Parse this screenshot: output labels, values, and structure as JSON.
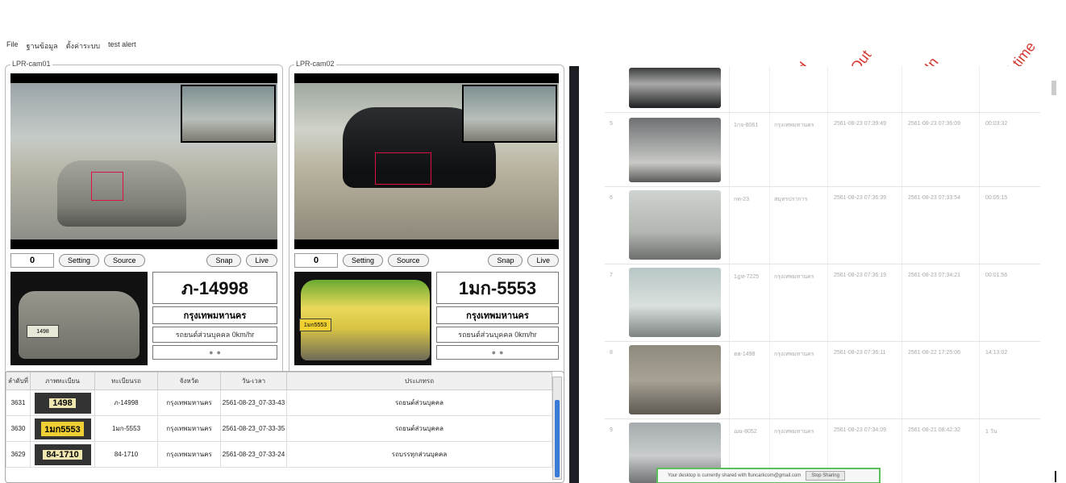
{
  "menu": [
    "File",
    "ฐานข้อมูล",
    "ตั้งค่าระบบ",
    "test alert"
  ],
  "cameras": [
    {
      "label": "LPR-cam01",
      "count": "0",
      "buttons": {
        "setting": "Setting",
        "source": "Source",
        "snap": "Snap",
        "live": "Live"
      },
      "plate": "ภ-14998",
      "province": "กรุงเทพมหานคร",
      "vehicle_type": "รถยนต์ส่วนบุคคล 0km/hr",
      "crop_plate": "1498"
    },
    {
      "label": "LPR-cam02",
      "count": "0",
      "buttons": {
        "setting": "Setting",
        "source": "Source",
        "snap": "Snap",
        "live": "Live"
      },
      "plate": "1มก-5553",
      "province": "กรุงเทพมหานคร",
      "vehicle_type": "รถยนต์ส่วนบุคคล 0km/hr",
      "crop_plate": "1มก5553"
    }
  ],
  "grid": {
    "headers": [
      "ลำดับที่",
      "ภาพทะเบียน",
      "ทะเบียนรถ",
      "จังหวัด",
      "วัน-เวลา",
      "ประเภทรถ"
    ],
    "rows": [
      {
        "no": "3631",
        "thumb": "1498",
        "plate": "ภ-14998",
        "province": "กรุงเทพมหานคร",
        "time": "2561-08-23_07-33-43",
        "type": "รถยนต์ส่วนบุคคล"
      },
      {
        "no": "3630",
        "thumb": "1มก5553",
        "plate": "1มก-5553",
        "province": "กรุงเทพมหานคร",
        "time": "2561-08-23_07-33-35",
        "type": "รถยนต์ส่วนบุคคล"
      },
      {
        "no": "3629",
        "thumb": "84-1710",
        "plate": "84-1710",
        "province": "กรุงเทพมหานคร",
        "time": "2561-08-23_07-33-24",
        "type": "รถบรรทุกส่วนบุคคล"
      }
    ]
  },
  "web": {
    "headings": [
      "Brand",
      "Time Out",
      "Time In",
      "period time"
    ],
    "rows": [
      {
        "no": "",
        "plate": "",
        "brand": "",
        "time_out": "",
        "time_in": "",
        "period": ""
      },
      {
        "no": "5",
        "plate": "1กจ-8061",
        "brand": "กรุงเทพมหานคร",
        "time_out": "2561-08-23 07:39:49",
        "time_in": "2561-08-23 07:36:09",
        "period": "00:03:32"
      },
      {
        "no": "6",
        "plate": "กท-23",
        "brand": "สมุทรปราการ",
        "time_out": "2561-08-23 07:36:39",
        "time_in": "2561-08-23 07:33:54",
        "period": "00:05:15"
      },
      {
        "no": "7",
        "plate": "1ฎท-7225",
        "brand": "กรุงเทพมหานคร",
        "time_out": "2561-08-23 07:36:19",
        "time_in": "2561-08-23 07:34:21",
        "period": "00:01:56"
      },
      {
        "no": "8",
        "plate": "ฮฮ-1498",
        "brand": "กรุงเทพมหานคร",
        "time_out": "2561-08-23 07:36:11",
        "time_in": "2561-08-22 17:25:06",
        "period": "14:13:02"
      },
      {
        "no": "9",
        "plate": "ฌฉ-8052",
        "brand": "กรุงเทพมหานคร",
        "time_out": "2561-08-23 07:34:09",
        "time_in": "2561-08-21 08:42:32",
        "period": "1 วัน"
      }
    ],
    "share_text": "Your desktop is currently shared with fluncarkcom@gmail.com",
    "stop_sharing": "Stop Sharing"
  }
}
